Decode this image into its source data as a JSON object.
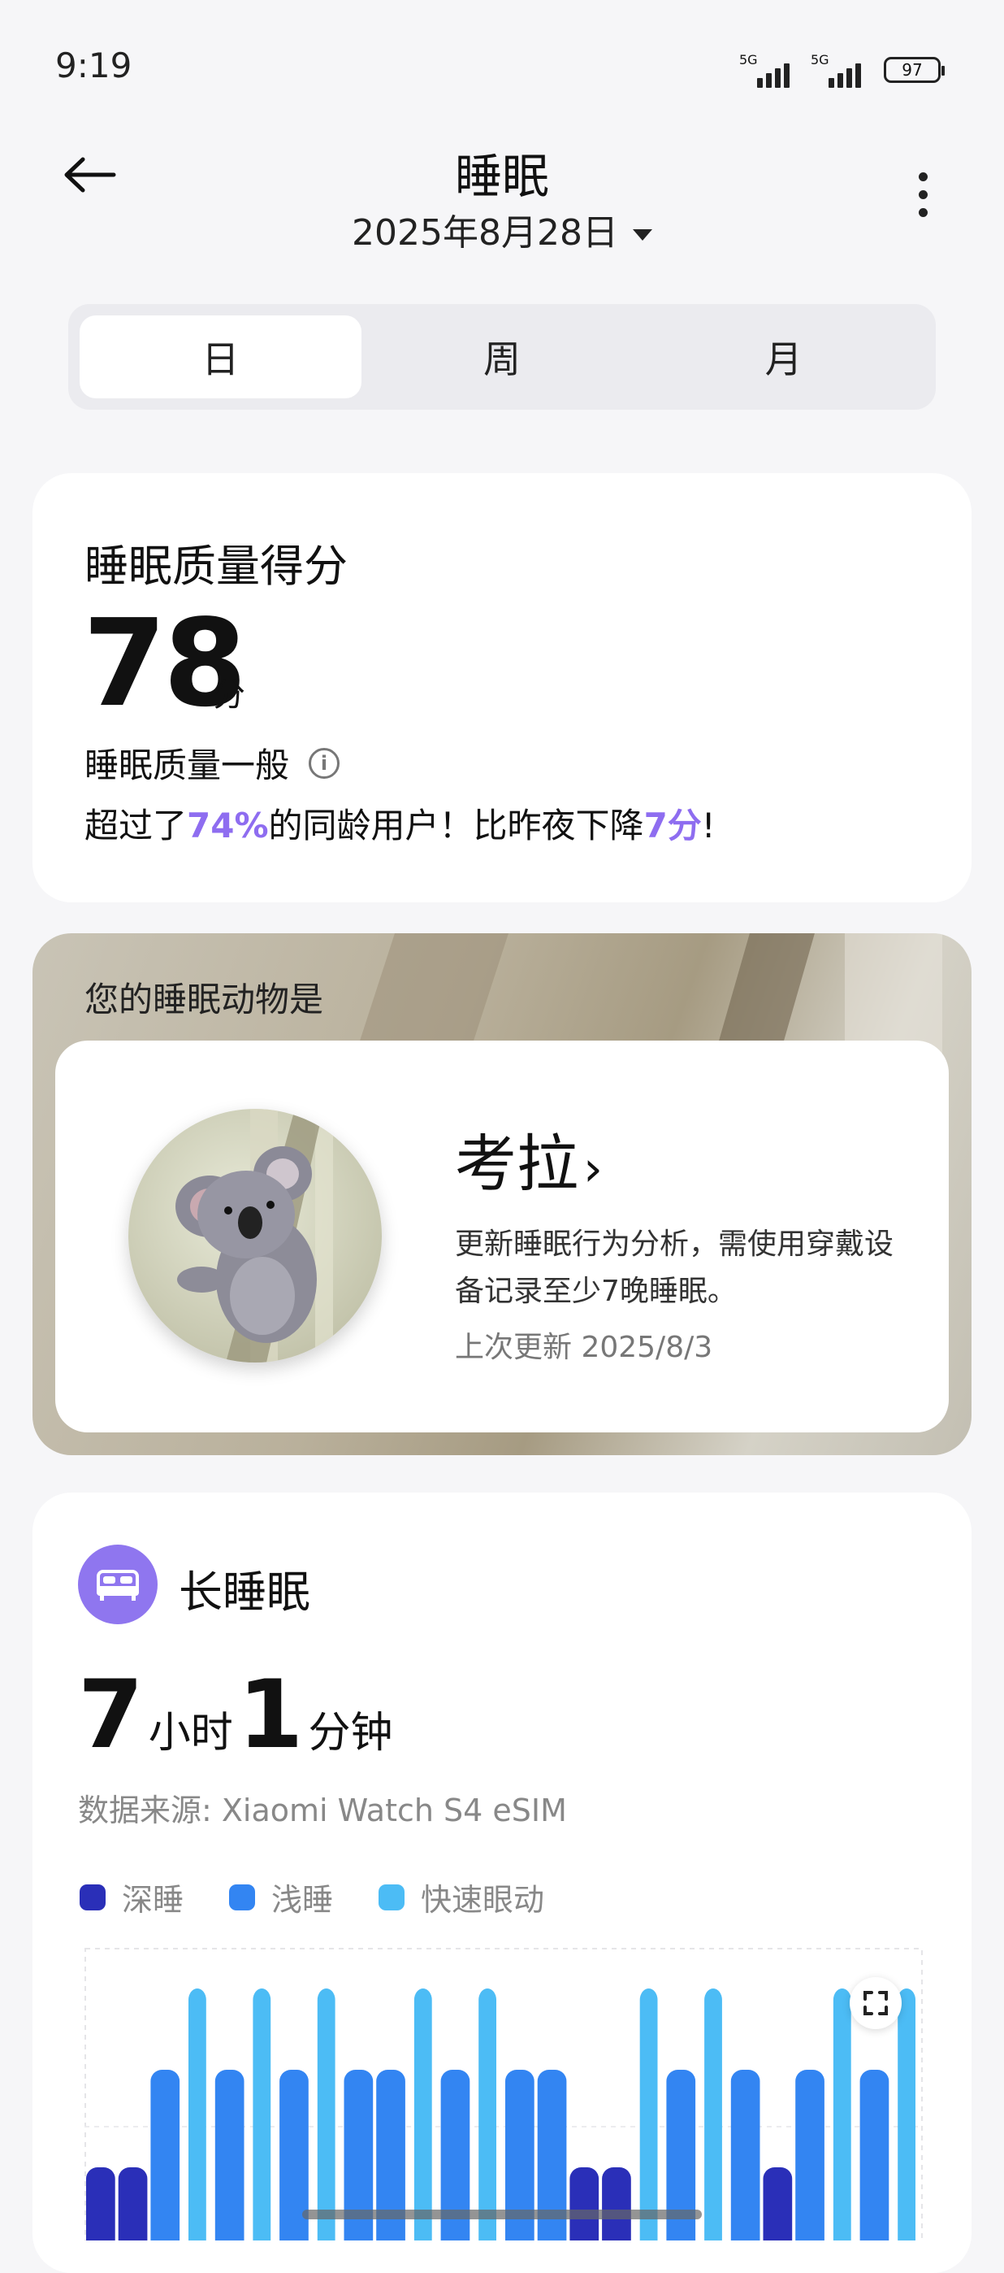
{
  "status": {
    "time": "9:19",
    "net1": "5G",
    "net2": "5G",
    "battery": "97"
  },
  "header": {
    "title": "睡眠",
    "date": "2025年8月28日"
  },
  "tabs": [
    {
      "label": "日",
      "active": true
    },
    {
      "label": "周"
    },
    {
      "label": "月"
    }
  ],
  "score_card": {
    "heading": "睡眠质量得分",
    "score": "78",
    "unit": "分",
    "quality": "睡眠质量一般",
    "cmp_pre": "超过了",
    "cmp_pct": "74%",
    "cmp_mid": "的同龄用户！比昨夜下降",
    "cmp_drop": "7分",
    "cmp_end": "!"
  },
  "animal_card": {
    "label": "您的睡眠动物是",
    "animal": "考拉",
    "description": "更新睡眠行为分析，需使用穿戴设备记录至少7晚睡眠。",
    "updated": "上次更新 2025/8/3"
  },
  "sleep_card": {
    "title": "长睡眠",
    "hours": "7",
    "hours_unit": "小时",
    "minutes": "1",
    "minutes_unit": "分钟",
    "source": "数据来源: Xiaomi Watch S4 eSIM",
    "legend": [
      {
        "label": "深睡",
        "color": "#2a2fb8"
      },
      {
        "label": "浅睡",
        "color": "#3385f2"
      },
      {
        "label": "快速眼动",
        "color": "#4cbcf5"
      }
    ]
  },
  "chart_data": {
    "type": "bar",
    "stage_sequence": [
      "deep",
      "deep",
      "light",
      "rem",
      "light",
      "rem",
      "light",
      "rem",
      "light",
      "light",
      "rem",
      "light",
      "rem",
      "light",
      "light",
      "deep",
      "deep",
      "rem",
      "light",
      "rem",
      "light",
      "deep",
      "light",
      "rem",
      "light",
      "rem"
    ]
  },
  "colors": {
    "accent": "#8e6df0",
    "deep": "#2a2fb8",
    "light": "#3385f2",
    "rem": "#4cbcf5"
  }
}
